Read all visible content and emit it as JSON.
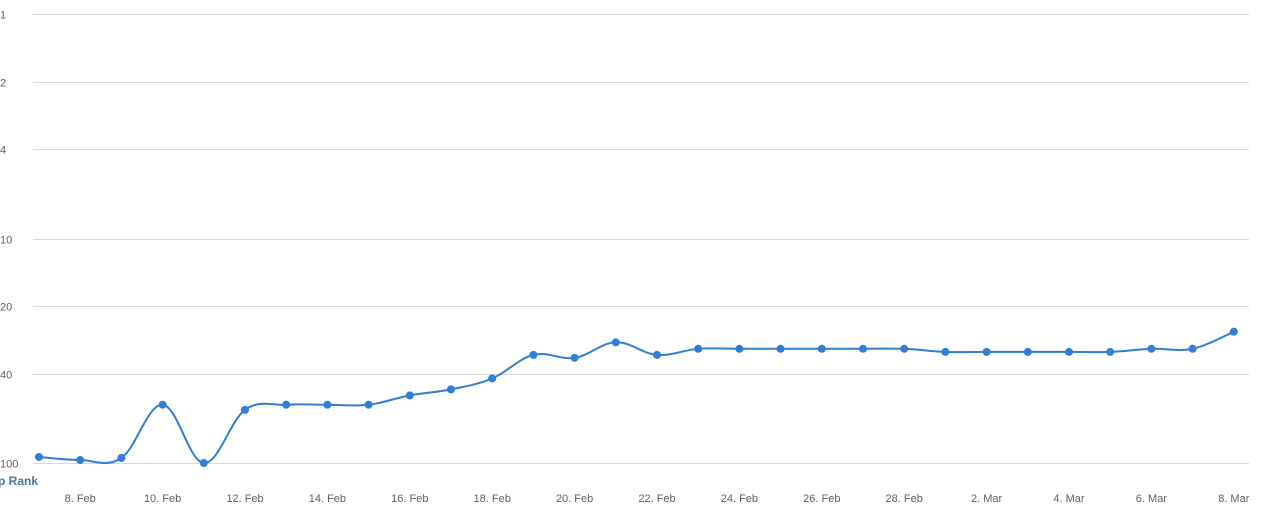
{
  "chart_data": {
    "type": "line",
    "title": "",
    "xlabel": "",
    "ylabel": "App Rank",
    "ylabel_visible_text": "p Rank",
    "y_scale": "log",
    "y_reversed": true,
    "ylim": [
      1,
      100
    ],
    "y_ticks": [
      1,
      2,
      4,
      10,
      20,
      40,
      100
    ],
    "x_tick_labels": [
      "8. Feb",
      "10. Feb",
      "12. Feb",
      "14. Feb",
      "16. Feb",
      "18. Feb",
      "20. Feb",
      "22. Feb",
      "24. Feb",
      "26. Feb",
      "28. Feb",
      "2. Mar",
      "4. Mar",
      "6. Mar",
      "8. Mar"
    ],
    "x": [
      "7. Feb",
      "8. Feb",
      "9. Feb",
      "10. Feb",
      "11. Feb",
      "12. Feb",
      "13. Feb",
      "14. Feb",
      "15. Feb",
      "16. Feb",
      "17. Feb",
      "18. Feb",
      "19. Feb",
      "20. Feb",
      "21. Feb",
      "22. Feb",
      "23. Feb",
      "24. Feb",
      "25. Feb",
      "26. Feb",
      "27. Feb",
      "28. Feb",
      "1. Mar",
      "2. Mar",
      "3. Mar",
      "4. Mar",
      "5. Mar",
      "6. Mar",
      "7. Mar",
      "8. Mar"
    ],
    "series": [
      {
        "values": [
          94,
          97,
          95,
          55,
          100,
          58,
          55,
          55,
          55,
          50,
          47,
          42,
          33,
          34,
          29,
          33,
          31,
          31,
          31,
          31,
          31,
          31,
          32,
          32,
          32,
          32,
          32,
          31,
          31,
          26
        ]
      }
    ],
    "grid": true,
    "legend": "none",
    "line_color": "#2f7ed8"
  }
}
